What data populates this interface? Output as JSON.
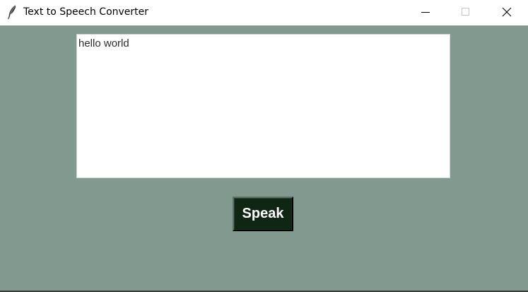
{
  "window": {
    "title": "Text to Speech Converter",
    "icon": "feather-icon",
    "controls": [
      "minimize-icon",
      "maximize-icon",
      "close-icon"
    ]
  },
  "main": {
    "background_color": "#81998f",
    "text_input": {
      "value": "hello world"
    },
    "speak_button": {
      "label": "Speak",
      "background_color": "#0f2615",
      "text_color": "#ffffff"
    }
  }
}
